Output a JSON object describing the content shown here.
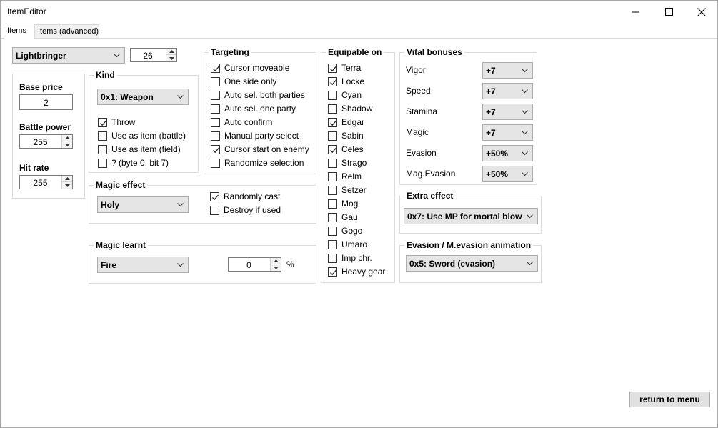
{
  "window": {
    "title": "ItemEditor"
  },
  "tabs": [
    "Items",
    "Items (advanced)"
  ],
  "item_select": {
    "value": "Lightbringer",
    "index": "26"
  },
  "price_group": {
    "base_price_label": "Base price",
    "base_price": "2",
    "battle_power_label": "Battle power",
    "battle_power": "255",
    "hit_rate_label": "Hit rate",
    "hit_rate": "255"
  },
  "kind": {
    "title": "Kind",
    "value": "0x1: Weapon",
    "checks": [
      {
        "label": "Throw",
        "checked": true
      },
      {
        "label": "Use as item (battle)",
        "checked": false
      },
      {
        "label": "Use as item (field)",
        "checked": false
      },
      {
        "label": "? (byte 0, bit 7)",
        "checked": false
      }
    ]
  },
  "targeting": {
    "title": "Targeting",
    "checks": [
      {
        "label": "Cursor moveable",
        "checked": true
      },
      {
        "label": "One side only",
        "checked": false
      },
      {
        "label": "Auto sel. both parties",
        "checked": false
      },
      {
        "label": "Auto sel. one party",
        "checked": false
      },
      {
        "label": "Auto confirm",
        "checked": false
      },
      {
        "label": "Manual party select",
        "checked": false
      },
      {
        "label": "Cursor start on enemy",
        "checked": true
      },
      {
        "label": "Randomize selection",
        "checked": false
      }
    ]
  },
  "magic_effect": {
    "title": "Magic effect",
    "value": "Holy",
    "checks": [
      {
        "label": "Randomly cast",
        "checked": true
      },
      {
        "label": "Destroy if used",
        "checked": false
      }
    ]
  },
  "magic_learnt": {
    "title": "Magic learnt",
    "value": "Fire",
    "rate": "0",
    "unit": "%"
  },
  "equipable": {
    "title": "Equipable on",
    "checks": [
      {
        "label": "Terra",
        "checked": true
      },
      {
        "label": "Locke",
        "checked": true
      },
      {
        "label": "Cyan",
        "checked": false
      },
      {
        "label": "Shadow",
        "checked": false
      },
      {
        "label": "Edgar",
        "checked": true
      },
      {
        "label": "Sabin",
        "checked": false
      },
      {
        "label": "Celes",
        "checked": true
      },
      {
        "label": "Strago",
        "checked": false
      },
      {
        "label": "Relm",
        "checked": false
      },
      {
        "label": "Setzer",
        "checked": false
      },
      {
        "label": "Mog",
        "checked": false
      },
      {
        "label": "Gau",
        "checked": false
      },
      {
        "label": "Gogo",
        "checked": false
      },
      {
        "label": "Umaro",
        "checked": false
      },
      {
        "label": "Imp chr.",
        "checked": false
      },
      {
        "label": "Heavy gear",
        "checked": true
      }
    ]
  },
  "vital": {
    "title": "Vital bonuses",
    "rows": [
      {
        "label": "Vigor",
        "value": "+7"
      },
      {
        "label": "Speed",
        "value": "+7"
      },
      {
        "label": "Stamina",
        "value": "+7"
      },
      {
        "label": "Magic",
        "value": "+7"
      },
      {
        "label": "Evasion",
        "value": "+50%"
      },
      {
        "label": "Mag.Evasion",
        "value": "+50%"
      }
    ]
  },
  "extra_effect": {
    "title": "Extra effect",
    "value": "0x7: Use MP for mortal blow"
  },
  "evasion_anim": {
    "title": "Evasion / M.evasion animation",
    "value": "0x5: Sword (evasion)"
  },
  "return_button": "return to menu"
}
